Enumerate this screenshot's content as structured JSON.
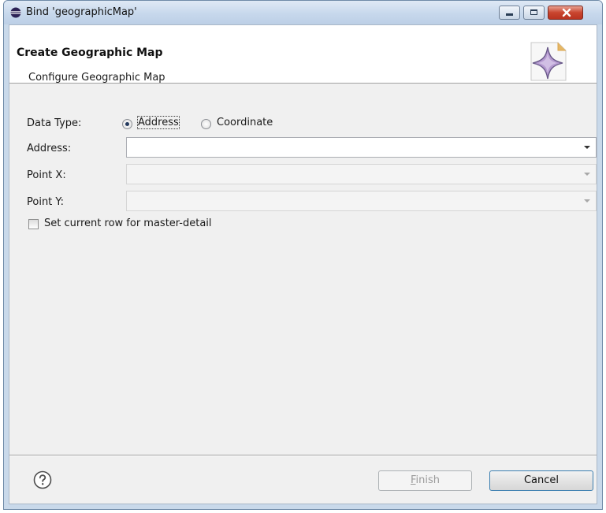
{
  "window": {
    "title": "Bind 'geographicMap'"
  },
  "header": {
    "title": "Create Geographic Map",
    "description": "Configure Geographic Map"
  },
  "form": {
    "data_type_label": "Data Type:",
    "data_type_options": [
      {
        "label": "Address",
        "selected": true
      },
      {
        "label": "Coordinate",
        "selected": false
      }
    ],
    "address_label": "Address:",
    "address_value": "",
    "point_x_label": "Point X:",
    "point_x_value": "",
    "point_y_label": "Point Y:",
    "point_y_value": "",
    "master_detail_label": "Set current row for master-detail",
    "master_detail_checked": false
  },
  "footer": {
    "finish_label": "Finish",
    "finish_mnemonic": "F",
    "finish_rest": "inish",
    "cancel_label": "Cancel"
  },
  "icons": {
    "app": "eclipse-icon",
    "wizard": "wizard-star-icon",
    "help": "help-icon"
  },
  "colors": {
    "titlebar": "#c7d8ec",
    "close_button": "#c9452f",
    "dialog_bg": "#f0f0f0"
  }
}
